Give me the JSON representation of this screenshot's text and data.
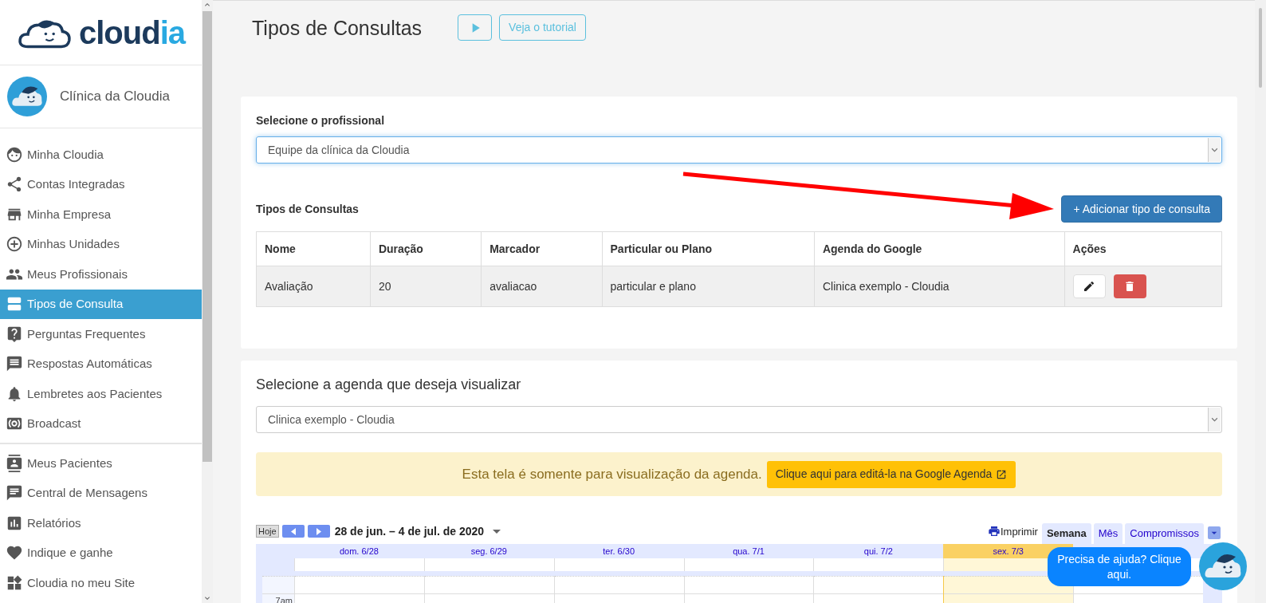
{
  "sidebar": {
    "logo": {
      "main": "cloud",
      "accent": "ia"
    },
    "clinic_name": "Clínica da Cloudia",
    "groups": [
      [
        {
          "label": "Minha Cloudia",
          "selected": false
        },
        {
          "label": "Contas Integradas",
          "selected": false
        },
        {
          "label": "Minha Empresa",
          "selected": false
        },
        {
          "label": "Minhas Unidades",
          "selected": false
        },
        {
          "label": "Meus Profissionais",
          "selected": false
        },
        {
          "label": "Tipos de Consulta",
          "selected": true
        },
        {
          "label": "Perguntas Frequentes",
          "selected": false
        },
        {
          "label": "Respostas Automáticas",
          "selected": false
        },
        {
          "label": "Lembretes aos Pacientes",
          "selected": false
        },
        {
          "label": "Broadcast",
          "selected": false
        }
      ],
      [
        {
          "label": "Meus Pacientes",
          "selected": false
        },
        {
          "label": "Central de Mensagens",
          "selected": false
        },
        {
          "label": "Relatórios",
          "selected": false
        },
        {
          "label": "Indique e ganhe",
          "selected": false
        },
        {
          "label": "Cloudia no meu Site",
          "selected": false
        }
      ]
    ]
  },
  "header": {
    "title": "Tipos de Consultas",
    "tutorial_button": "Veja o tutorial"
  },
  "professional": {
    "label": "Selecione o profissional",
    "value": "Equipe da clínica da Cloudia"
  },
  "consult_types": {
    "title": "Tipos de Consultas",
    "add_button": "+ Adicionar tipo de consulta",
    "columns": [
      "Nome",
      "Duração",
      "Marcador",
      "Particular ou Plano",
      "Agenda do Google",
      "Ações"
    ],
    "rows": [
      {
        "cells": [
          "Avaliação",
          "20",
          "avaliacao",
          "particular e plano",
          "Clinica exemplo - Cloudia"
        ]
      }
    ]
  },
  "agenda": {
    "title": "Selecione a agenda que deseja visualizar",
    "value": "Clinica exemplo - Cloudia",
    "notice": "Esta tela é somente para visualização da agenda.",
    "edit_button": "Clique aqui para editá-la na Google Agenda"
  },
  "calendar": {
    "today_button": "Hoje",
    "range": "28 de jun. – 4 de jul. de 2020",
    "print": "Imprimir",
    "views": [
      {
        "label": "Semana",
        "selected": true
      },
      {
        "label": "Mês",
        "selected": false
      },
      {
        "label": "Compromissos",
        "selected": false
      }
    ],
    "days": [
      {
        "label": "dom. 6/28",
        "today": false
      },
      {
        "label": "seg. 6/29",
        "today": false
      },
      {
        "label": "ter. 6/30",
        "today": false
      },
      {
        "label": "qua. 7/1",
        "today": false
      },
      {
        "label": "qui. 7/2",
        "today": false
      },
      {
        "label": "sex. 7/3",
        "today": true
      },
      {
        "today": false
      }
    ],
    "hours": [
      "7am"
    ]
  },
  "help": {
    "text": "Precisa de ajuda? Clique aqui."
  }
}
